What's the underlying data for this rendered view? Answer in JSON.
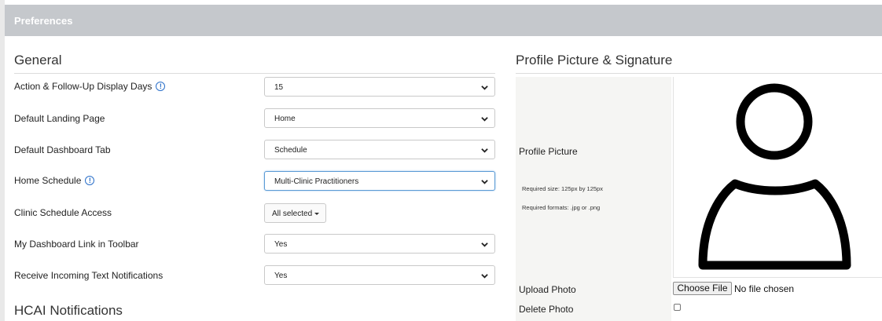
{
  "header": {
    "title": "Preferences"
  },
  "general": {
    "title": "General",
    "rows": [
      {
        "label": "Action & Follow-Up Display Days",
        "value": "15"
      },
      {
        "label": "Default Landing Page",
        "value": "Home"
      },
      {
        "label": "Default Dashboard Tab",
        "value": "Schedule"
      },
      {
        "label": "Home Schedule",
        "value": "Multi-Clinic Practitioners"
      },
      {
        "label": "Clinic Schedule Access",
        "value": "All selected"
      },
      {
        "label": "My Dashboard Link in Toolbar",
        "value": "Yes"
      },
      {
        "label": "Receive Incoming Text Notifications",
        "value": "Yes"
      }
    ]
  },
  "hcai": {
    "title": "HCAI Notifications"
  },
  "profile": {
    "title": "Profile Picture & Signature",
    "picture_label": "Profile Picture",
    "required_size": "Required size: 125px by 125px",
    "required_formats": "Required formats: .jpg or .png",
    "upload_label": "Upload Photo",
    "choose_file_label": "Choose File",
    "file_status": "No file chosen",
    "delete_label": "Delete Photo"
  },
  "colors": {
    "header_bg": "#c5c8cc",
    "info_icon": "#2a6fc9",
    "focus_border": "#5b9bd5"
  }
}
